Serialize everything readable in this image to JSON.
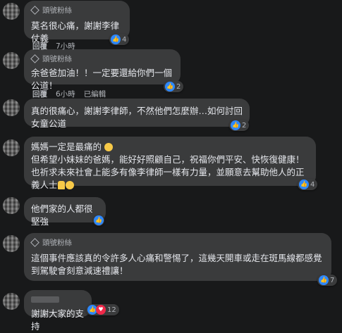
{
  "comments": [
    {
      "badge": "頭號粉絲",
      "text": "莫名很心痛，謝謝李律仗義",
      "count": "4"
    },
    {
      "badge": "頭號粉絲",
      "text": "余爸爸加油！！一定要還給你們一個公道！",
      "count": "2",
      "actions": {
        "like": "回覆",
        "reply": "6小時",
        "time": "已編輯"
      }
    },
    {
      "text": "真的很痛心，謝謝李律師，不然他們怎麼辦…如何討回女童公道",
      "count": "2",
      "actions": {
        "like": "回覆",
        "time": "7小時"
      }
    },
    {
      "text": "媽媽一定是最痛的",
      "text2": "但希望小妹妹的爸媽，能好好照顧自己，祝福你們平安、快恢復健康！",
      "text3": "也祈求未來社會上能多有像李律師一樣有力量，並願意去幫助他人的正義人士",
      "count": "4"
    },
    {
      "text": "他們家的人都很堅強"
    },
    {
      "badge": "頭號粉絲",
      "text": "這個事件應該真的令許多人心痛和警惕了，這幾天開車或走在斑馬線都感覺到駕駛會刻意減速禮讓！",
      "count": "7"
    },
    {
      "text": "謝謝大家的支持",
      "count": "12"
    }
  ],
  "row1_actions": {
    "a": "回覆",
    "b": "7小時"
  },
  "row2_actions": {
    "a": "回覆",
    "b": "6小時",
    "c": "已編輯"
  }
}
